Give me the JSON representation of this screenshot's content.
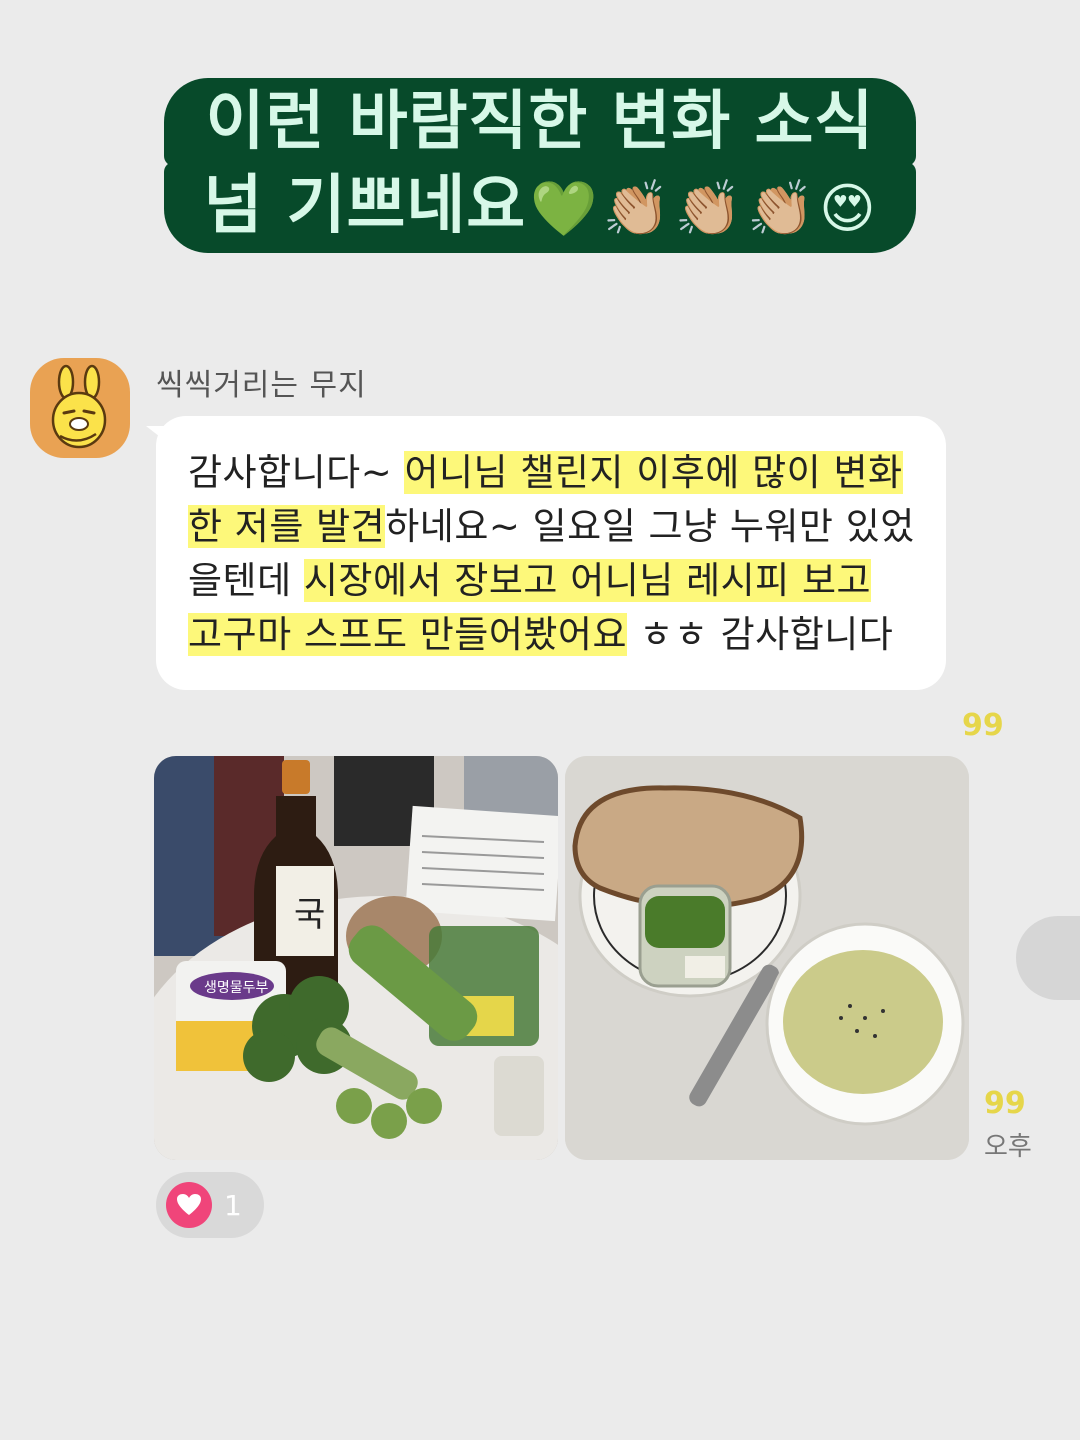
{
  "banner": {
    "line1": "이런 바람직한 변화 소식",
    "line2": "넘 기쁘네요",
    "emojis": [
      "💚",
      "👏🏼",
      "👏🏼",
      "👏🏼",
      "😍"
    ]
  },
  "message": {
    "sender": "씩씩거리는 무지",
    "segments": [
      {
        "text": "감사합니다~ ",
        "hl": false
      },
      {
        "text": "어니님 챌린지 이후에 많이 변화한 저를 발견",
        "hl": true
      },
      {
        "text": "하네요~ 일요일 그냥 누워만 있었을텐데 ",
        "hl": false
      },
      {
        "text": "시장에서 장보고 어니님 레시피 보고 고구마 스프도 만들어봤어요",
        "hl": true
      },
      {
        "text": " ㅎㅎ 감사합니다",
        "hl": false
      }
    ],
    "unread_text": "99",
    "unread_photo": "99",
    "time": "오후"
  },
  "photos": [
    {
      "name": "groceries-photo",
      "labels": {
        "soy": "국",
        "tofu": "생명물두부"
      }
    },
    {
      "name": "soup-and-bread-photo"
    }
  ],
  "reaction": {
    "icon": "heart-icon",
    "count": "1"
  },
  "colors": {
    "background": "#ebebeb",
    "banner_bg": "#074a2a",
    "banner_text": "#d7f8e8",
    "highlight": "#fdf87a",
    "unread": "#e6d64a",
    "heart": "#f0457a"
  }
}
